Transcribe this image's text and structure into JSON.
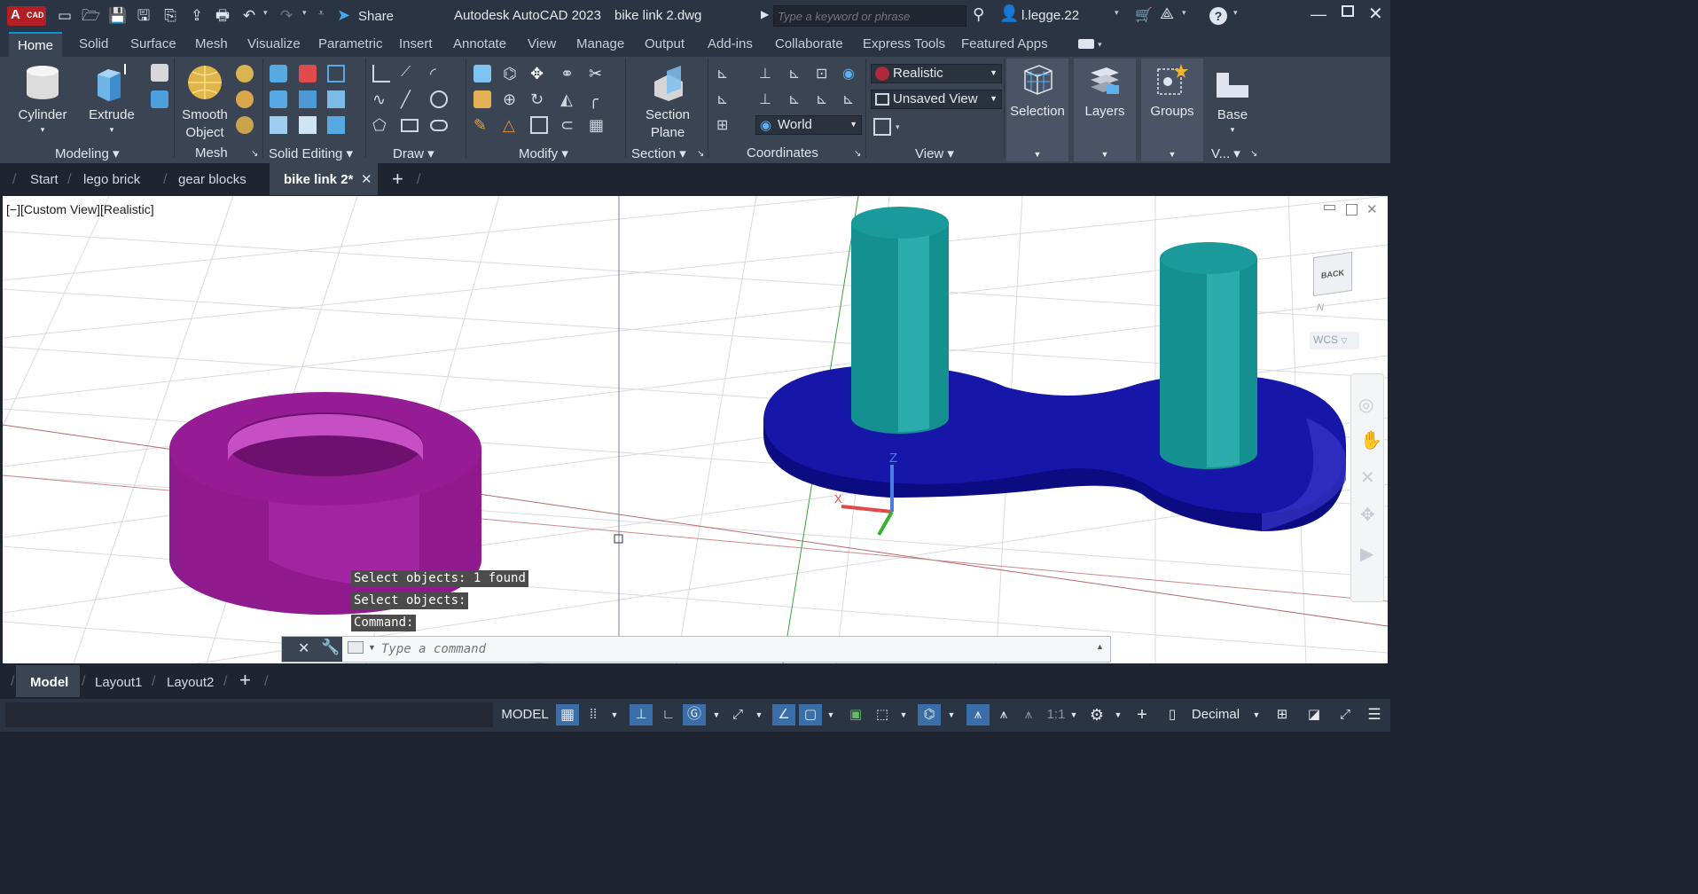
{
  "titlebar": {
    "app_badge": "A",
    "app_badge_sub": "CAD",
    "share_label": "Share",
    "app_title": "Autodesk AutoCAD 2023",
    "file_title": "bike link 2.dwg",
    "search_placeholder": "Type a keyword or phrase",
    "user_name": "l.legge.22",
    "help_label": "?"
  },
  "ribbon_tabs": [
    "Home",
    "Solid",
    "Surface",
    "Mesh",
    "Visualize",
    "Parametric",
    "Insert",
    "Annotate",
    "View",
    "Manage",
    "Output",
    "Add-ins",
    "Collaborate",
    "Express Tools",
    "Featured Apps"
  ],
  "ribbon": {
    "cylinder_label": "Cylinder",
    "extrude_label": "Extrude",
    "smooth_object_label1": "Smooth",
    "smooth_object_label2": "Object",
    "section_plane_label1": "Section",
    "section_plane_label2": "Plane",
    "visual_style": "Realistic",
    "named_view": "Unsaved View",
    "ucs_name": "World",
    "selection_label": "Selection",
    "layers_label": "Layers",
    "groups_label": "Groups",
    "base_label": "Base",
    "panels": {
      "modeling": "Modeling",
      "mesh": "Mesh",
      "solid_editing": "Solid Editing",
      "draw": "Draw",
      "modify": "Modify",
      "section": "Section",
      "coordinates": "Coordinates",
      "view": "View",
      "view_short": "V..."
    }
  },
  "doc_tabs": [
    "Start",
    "lego brick",
    "gear blocks",
    "bike link 2*"
  ],
  "viewport": {
    "view_label": "[−][Custom View][Realistic]",
    "viewcube_face": "BACK",
    "viewcube_n": "N",
    "wcs_label": "WCS",
    "ucs_z": "Z",
    "ucs_x": "X",
    "cmd_history": [
      "Select objects:",
      "1 found",
      "Select objects:",
      "Command:"
    ],
    "cmd_placeholder": "Type a command"
  },
  "layout_tabs": [
    "Model",
    "Layout1",
    "Layout2"
  ],
  "statusbar": {
    "model_label": "MODEL",
    "scale_label": "1:1",
    "units_label": "Decimal"
  },
  "colors": {
    "accent": "#0696d7",
    "ring": "#8e1a8e",
    "link_plate": "#1616a8",
    "pins": "#1a9a9a"
  }
}
